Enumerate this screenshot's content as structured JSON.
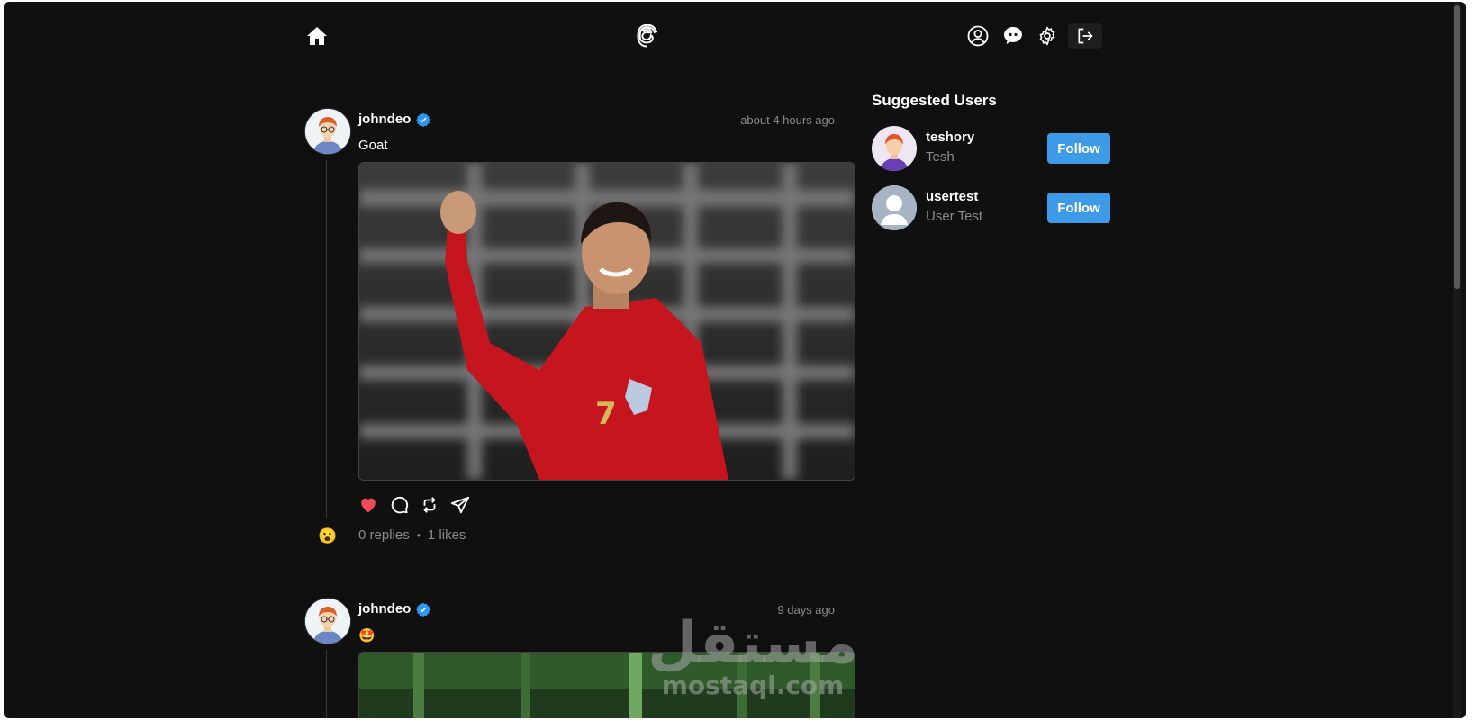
{
  "nav": {
    "home_icon": "home-icon",
    "logo_icon": "threads-logo-icon",
    "profile_icon": "user-circle-icon",
    "chat_icon": "chat-bubbles-icon",
    "settings_icon": "gear-icon",
    "logout_icon": "logout-icon"
  },
  "posts": [
    {
      "username": "johndeo",
      "verified": true,
      "time": "about 4 hours ago",
      "text": "Goat",
      "image_desc": "player celebrating in red jersey",
      "liked": true,
      "replies": "0 replies",
      "likes": "1 likes",
      "reply_emoji": "😮"
    },
    {
      "username": "johndeo",
      "verified": true,
      "time": "9 days ago",
      "text": "🤩"
    }
  ],
  "suggested": {
    "title": "Suggested Users",
    "users": [
      {
        "username": "teshory",
        "name": "Tesh",
        "follow_label": "Follow"
      },
      {
        "username": "usertest",
        "name": "User Test",
        "follow_label": "Follow"
      }
    ]
  },
  "watermark": {
    "arabic": "مستقل",
    "latin": "mostaql.com"
  },
  "colors": {
    "background": "#101010",
    "accent": "#3d9ae6",
    "like": "#ed4956",
    "muted": "#8a8a8a"
  }
}
